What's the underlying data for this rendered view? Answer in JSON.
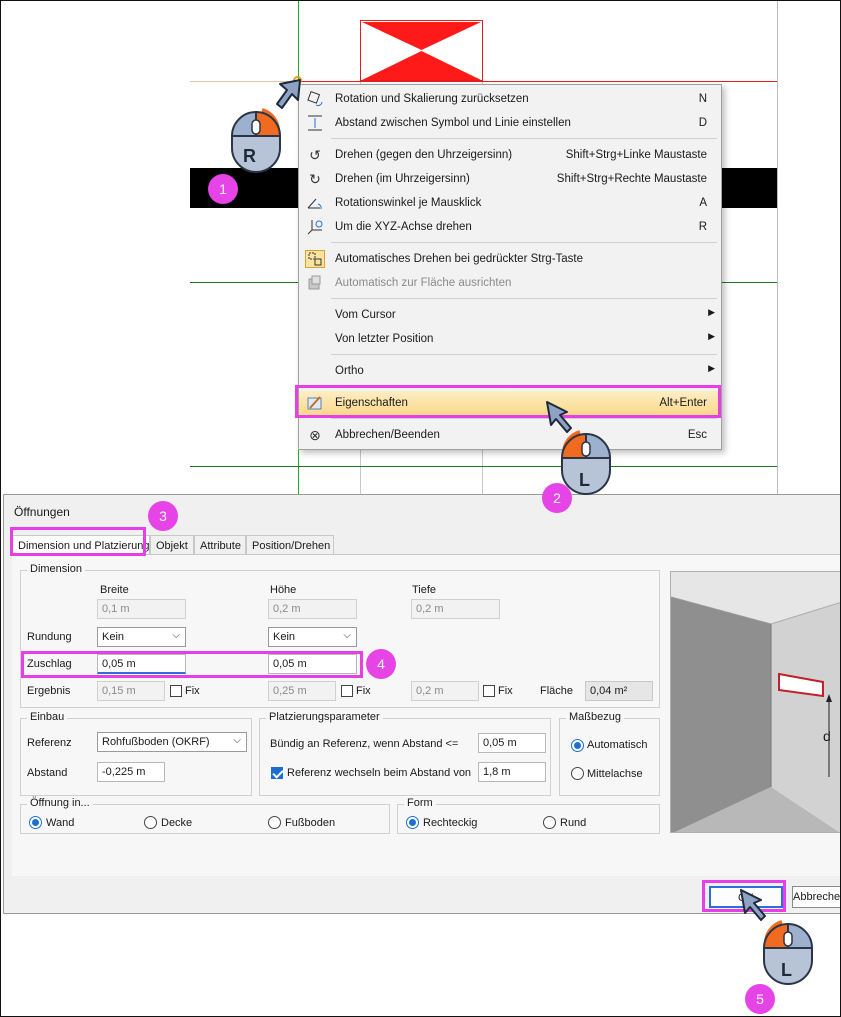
{
  "context_menu": {
    "items": [
      {
        "label": "Rotation und Skalierung zurücksetzen",
        "shortcut": "N"
      },
      {
        "label": "Abstand zwischen Symbol und Linie einstellen",
        "shortcut": "D"
      },
      {
        "label": "Drehen (gegen den Uhrzeigersinn)",
        "shortcut": "Shift+Strg+Linke Maustaste"
      },
      {
        "label": "Drehen (im Uhrzeigersinn)",
        "shortcut": "Shift+Strg+Rechte Maustaste"
      },
      {
        "label": "Rotationswinkel je Mausklick",
        "shortcut": "A"
      },
      {
        "label": "Um die XYZ-Achse drehen",
        "shortcut": "R"
      },
      {
        "label": "Automatisches Drehen bei gedrückter Strg-Taste",
        "shortcut": ""
      },
      {
        "label": "Automatisch zur Fläche ausrichten",
        "shortcut": ""
      },
      {
        "label": "Vom Cursor",
        "shortcut": ""
      },
      {
        "label": "Von letzter Position",
        "shortcut": ""
      },
      {
        "label": "Ortho",
        "shortcut": ""
      },
      {
        "label": "Eigenschaften",
        "shortcut": "Alt+Enter"
      },
      {
        "label": "Abbrechen/Beenden",
        "shortcut": "Esc"
      }
    ]
  },
  "mouse": {
    "right_letter": "R",
    "left_letter": "L"
  },
  "steps": [
    "1",
    "2",
    "3",
    "4",
    "5"
  ],
  "dialog": {
    "title": "Öffnungen",
    "tabs": [
      "Dimension und Platzierung",
      "Objekt",
      "Attribute",
      "Position/Drehen"
    ],
    "dimension": {
      "title": "Dimension",
      "col_breite": "Breite",
      "col_hoehe": "Höhe",
      "col_tiefe": "Tiefe",
      "breite": "0,1 m",
      "hoehe": "0,2 m",
      "tiefe": "0,2 m",
      "rundung_label": "Rundung",
      "rundung_breite": "Kein",
      "rundung_hoehe": "Kein",
      "zuschlag_label": "Zuschlag",
      "zuschlag_breite": "0,05 m",
      "zuschlag_hoehe": "0,05 m",
      "ergebnis_label": "Ergebnis",
      "ergebnis_breite": "0,15 m",
      "ergebnis_hoehe": "0,25 m",
      "ergebnis_tiefe": "0,2 m",
      "fix_label": "Fix",
      "flaeche_label": "Fläche",
      "flaeche": "0,04 m²"
    },
    "einbau": {
      "title": "Einbau",
      "referenz_label": "Referenz",
      "referenz": "Rohfußboden (OKRF)",
      "abstand_label": "Abstand",
      "abstand": "-0,225 m"
    },
    "platzierung": {
      "title": "Platzierungsparameter",
      "buendig_label": "Bündig an Referenz, wenn Abstand <=",
      "buendig_value": "0,05 m",
      "wechseln_label": "Referenz wechseln beim Abstand von",
      "wechseln_value": "1,8 m"
    },
    "massbezug": {
      "title": "Maßbezug",
      "options": [
        "Automatisch",
        "Mittelachse"
      ]
    },
    "oeffnung": {
      "title": "Öffnung in...",
      "options": [
        "Wand",
        "Decke",
        "Fußboden"
      ]
    },
    "form": {
      "title": "Form",
      "options": [
        "Rechteckig",
        "Rund"
      ]
    },
    "preview_label": "d",
    "buttons": {
      "ok": "OK",
      "cancel": "Abbrechen"
    }
  }
}
